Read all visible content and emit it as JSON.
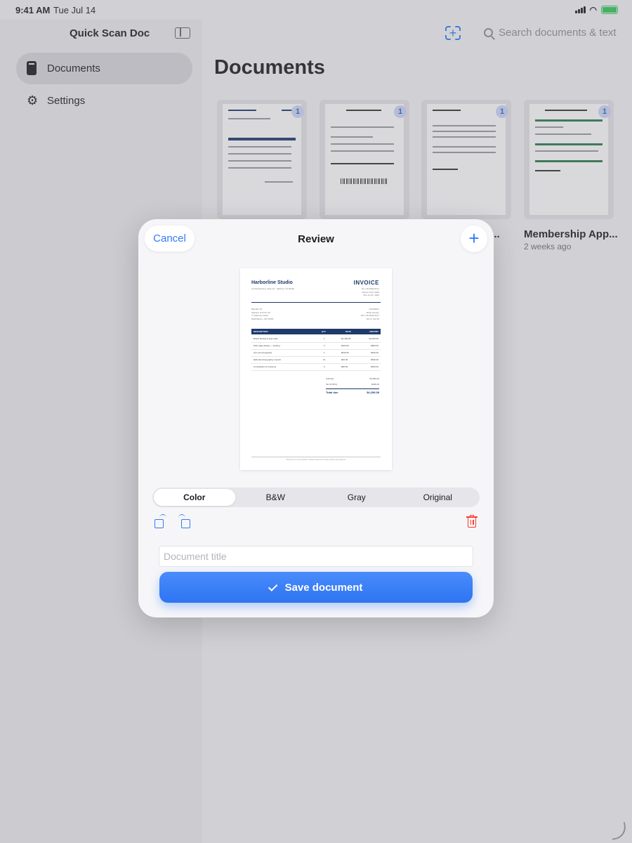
{
  "status": {
    "time": "9:41 AM",
    "date": "Tue Jul 14"
  },
  "app": {
    "title": "Quick Scan Doc"
  },
  "sidebar": {
    "items": [
      {
        "label": "Documents"
      },
      {
        "label": "Settings"
      }
    ]
  },
  "search": {
    "placeholder": "Search documents & text"
  },
  "main": {
    "title": "Documents",
    "documents": [
      {
        "name": "",
        "date": "",
        "pages": "1"
      },
      {
        "name": "",
        "date": "",
        "pages": "1"
      },
      {
        "name": "re...",
        "date": "",
        "pages": "1"
      },
      {
        "name": "Membership App...",
        "date": "2 weeks ago",
        "pages": "1"
      }
    ]
  },
  "review": {
    "title": "Review",
    "cancel_label": "Cancel",
    "filters": [
      "Color",
      "B&W",
      "Gray",
      "Original"
    ],
    "selected_filter": "Color",
    "title_placeholder": "Document title",
    "save_label": "Save document"
  },
  "invoice_preview": {
    "company": "Harborline Studio",
    "address": "4 Industrial Ave, Suite 12 · Harbour, CA 94110",
    "title": "INVOICE",
    "meta": [
      "No. HS-2026-0147",
      "Issued Jul 8, 2026",
      "Due Jul 31, 2026"
    ],
    "bill_to": [
      "BILLED TO",
      "Alphane & Finch Ltd",
      "77 Alderney Road",
      "Brighthaven, OR 97000"
    ],
    "payment": [
      "PAYMENT",
      "Bank transfer",
      "Ref: HS-2026-0147",
      "Terms: Net 30"
    ],
    "columns": [
      "DESCRIPTION",
      "QTY",
      "RATE",
      "AMOUNT"
    ],
    "rows": [
      {
        "desc": "Brand identity & logo suite",
        "qty": "1",
        "rate": "$1,400.00",
        "amount": "$1,400.00"
      },
      {
        "desc": "Web page design — landing",
        "qty": "3",
        "rate": "$320.00",
        "amount": "$960.00"
      },
      {
        "desc": "Icon set (24 glyphs)",
        "qty": "1",
        "rate": "$540.00",
        "amount": "$540.00"
      },
      {
        "desc": "Editorial photography retouch",
        "qty": "12",
        "rate": "$45.00",
        "amount": "$540.00"
      },
      {
        "desc": "Consultation & revisions",
        "qty": "6",
        "rate": "$90.00",
        "amount": "$540.00"
      }
    ],
    "subtotal_label": "Subtotal",
    "subtotal": "$3,980.00",
    "tax_label": "Tax (8.00%)",
    "tax": "$318.40",
    "total_label": "Total due",
    "total": "$4,298.38",
    "footer": "Thank you for your business. Please reference invoice number with payment."
  },
  "colors": {
    "accent": "#2f7cf6",
    "destructive": "#ff3b30",
    "invoice_navy": "#1d3a6b"
  }
}
